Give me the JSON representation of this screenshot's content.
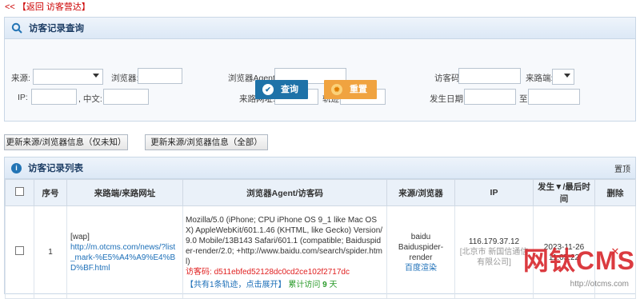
{
  "top": {
    "back_label": "【返回 访客营达】",
    "chevron": "<<"
  },
  "search": {
    "title": "访客记录查询",
    "labels": {
      "source": "来源:",
      "browser": "浏览器:",
      "agent": "浏览器Agent:",
      "visitor_code": "访客码:",
      "path_end": "来路端:",
      "ip": "IP:",
      "chinese": ", 中文:",
      "from_url": "来路网址:",
      "track": "轨迹:",
      "date": "发生日期:",
      "to": "至"
    },
    "query_button": "查询",
    "reset_button": "重置"
  },
  "actions": {
    "update_unknown": "更新来源/浏览器信息（仅未知）",
    "update_all": "更新来源/浏览器信息（全部）"
  },
  "list": {
    "title": "访客记录列表",
    "sort_link": "置顶",
    "headers": [
      "",
      "序号",
      "来路端/来路网址",
      "浏览器Agent/访客码",
      "来源/浏览器",
      "IP",
      "发生▼/最后时间",
      "删除"
    ],
    "rows": [
      {
        "index": "1",
        "path_type": "[wap]",
        "path_url": "http://m.otcms.com/news/?list_mark-%E5%A4%A9%E4%BD%BF.html",
        "agent": "Mozilla/5.0 (iPhone; CPU iPhone OS 9_1 like Mac OS X) AppleWebKit/601.1.46 (KHTML, like Gecko) Version/9.0 Mobile/13B143 Safari/601.1 (compatible; Baiduspider-render/2.0; +http://www.baidu.com/search/spider.html)",
        "visitor_code_label": "访客码:",
        "visitor_code": "d511ebfed52128dc0cd2ce102f2717dc",
        "track_prefix": "【共有",
        "track_count": "1",
        "track_suffix": "条轨迹，点击展开】",
        "visit_label": "累计访问",
        "visit_count": "9",
        "visit_unit": "天",
        "source": "baidu",
        "browser": "Baiduspider-render",
        "render_link": "百度渲染",
        "ip": "116.179.37.12",
        "ip_location": "[北京市 新国信通信有限公司]",
        "date": "2023-11-26",
        "time": "11:05:22"
      }
    ]
  },
  "watermark": {
    "text": "网钛CMS",
    "url": "http://otcms.com"
  }
}
